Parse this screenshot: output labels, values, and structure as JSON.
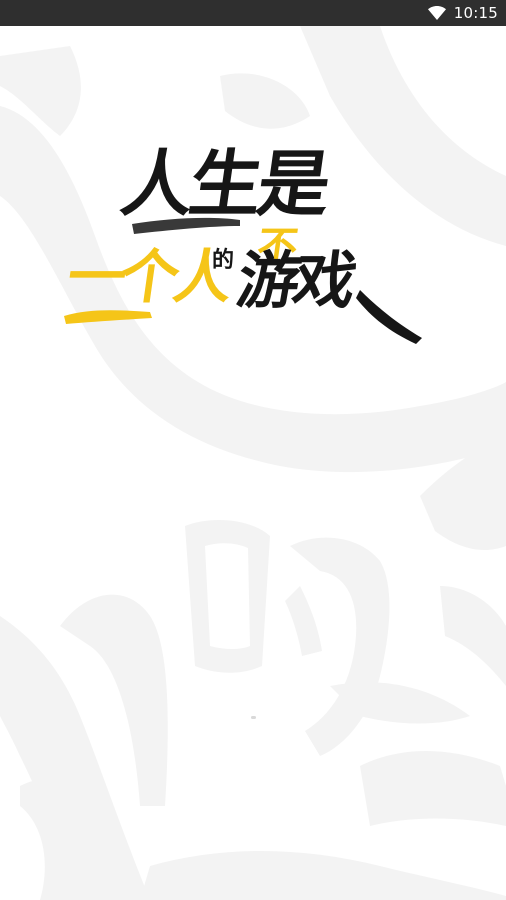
{
  "status_bar": {
    "time": "10:15",
    "wifi_icon": "wifi-icon"
  },
  "splash": {
    "logo": {
      "line1": "人生是",
      "small_char": "的",
      "yellow_char": "不",
      "line2_yellow": "一个人",
      "line2_black": "游戏"
    },
    "watermark_text": "人生的"
  },
  "colors": {
    "status_bar_bg": "#2f2f2f",
    "background": "#ffffff",
    "logo_black": "#161616",
    "logo_yellow": "#f5c518",
    "watermark": "#f2f2f2"
  }
}
